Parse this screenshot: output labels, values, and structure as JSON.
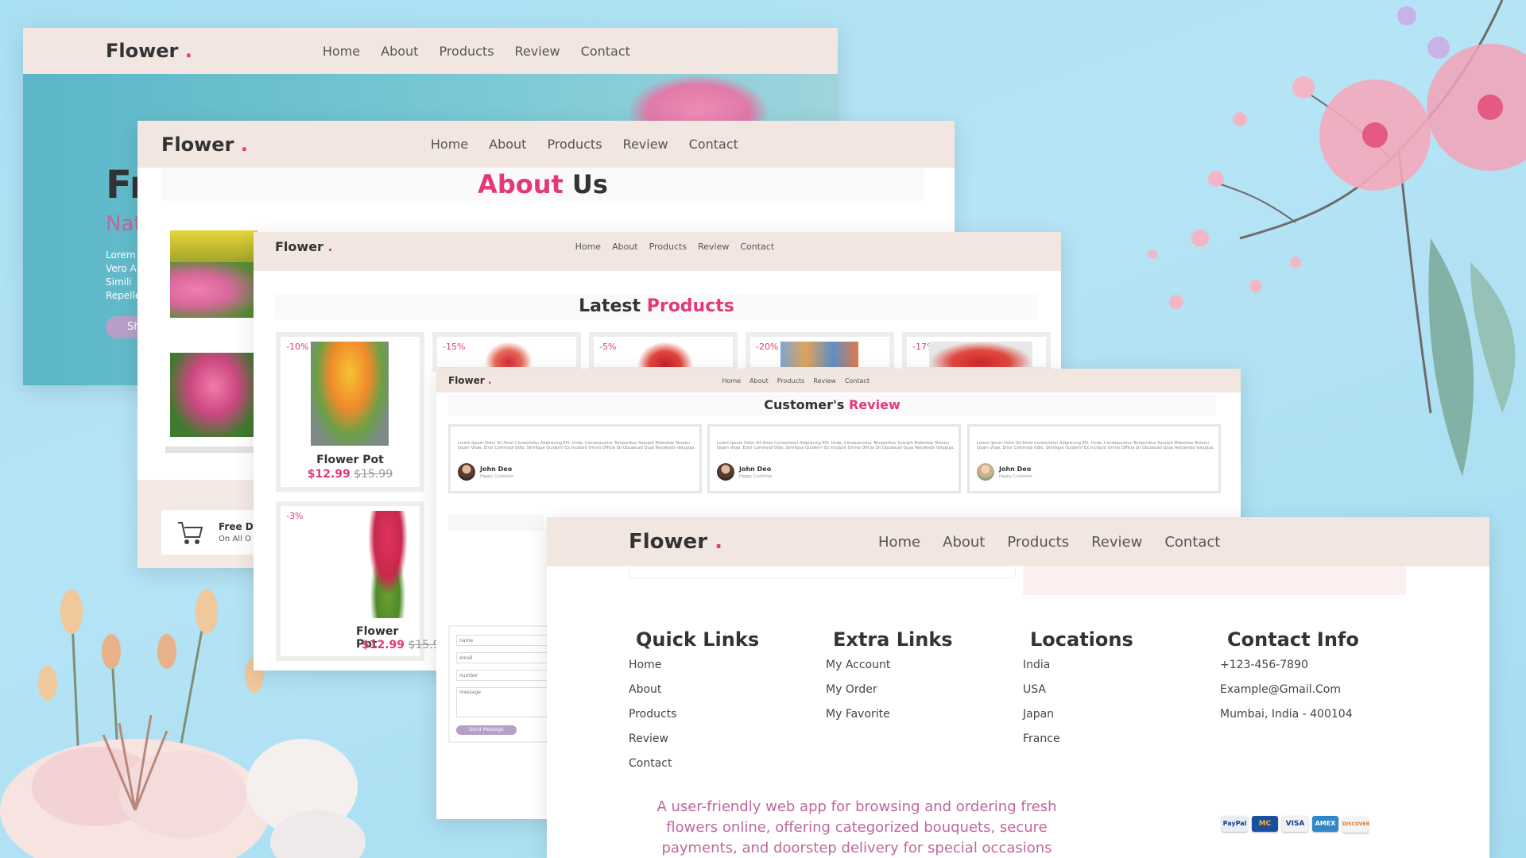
{
  "nav": {
    "logo": "Flower",
    "logo_dot": ".",
    "links": [
      "Home",
      "About",
      "Products",
      "Review",
      "Contact"
    ]
  },
  "hero": {
    "title_partial": "Fr",
    "subtitle_partial": "Nat",
    "lines": [
      "Lorem",
      "Vero A",
      "Simili",
      "Repelle"
    ],
    "button_partial": "Sh"
  },
  "about": {
    "title_word1": "About",
    "title_word2": "Us",
    "delivery_title": "Free D",
    "delivery_sub": "On All O"
  },
  "products": {
    "title_word1": "Latest",
    "title_word2": "Products",
    "discounts": [
      "-10%",
      "-15%",
      "-5%",
      "-20%",
      "-17%",
      "-3%"
    ],
    "items": [
      {
        "name": "Flower Pot",
        "price": "$12.99",
        "old_price": "$15.99"
      },
      {
        "name": "Flower Pot",
        "price": "$12.99",
        "old_price": "$15.9"
      }
    ]
  },
  "review": {
    "title_word1": "Customer's",
    "title_word2": "Review",
    "text": "Lorem Ipsum Dolor Sit Amet Consectetur Adipisicing Elit. Unde, Consequuntur Temporibus Suscipit Molestiae Tenetur Quam Vitae, Error Commodi Odio, Similique Quidem? Ex Incidunt Omnis Officia Sit Obcaecati Quas Reiciendis Voluptas.",
    "name": "John Deo",
    "role": "Happy Customer"
  },
  "contact_form": {
    "name": "name",
    "email": "email",
    "number": "number",
    "message": "message",
    "button": "Send Message"
  },
  "footer": {
    "columns": [
      {
        "title": "Quick Links",
        "items": [
          "Home",
          "About",
          "Products",
          "Review",
          "Contact"
        ]
      },
      {
        "title": "Extra Links",
        "items": [
          "My Account",
          "My Order",
          "My Favorite"
        ]
      },
      {
        "title": "Locations",
        "items": [
          "India",
          "USA",
          "Japan",
          "France"
        ]
      },
      {
        "title": "Contact Info",
        "items": [
          "+123-456-7890",
          "Example@Gmail.Com",
          "Mumbai, India - 400104"
        ]
      }
    ],
    "tagline": "A user-friendly web app for browsing and ordering fresh flowers online, offering categorized bouquets, secure payments, and doorstep delivery for special occasions",
    "payment": [
      "PayPal",
      "MC",
      "VISA",
      "AMEX",
      "DISCOVER"
    ]
  },
  "colors": {
    "accent": "#e2397b",
    "nav_bg": "#f2e6e1",
    "sky": "#a9dff3",
    "tagline": "#c0679b"
  }
}
